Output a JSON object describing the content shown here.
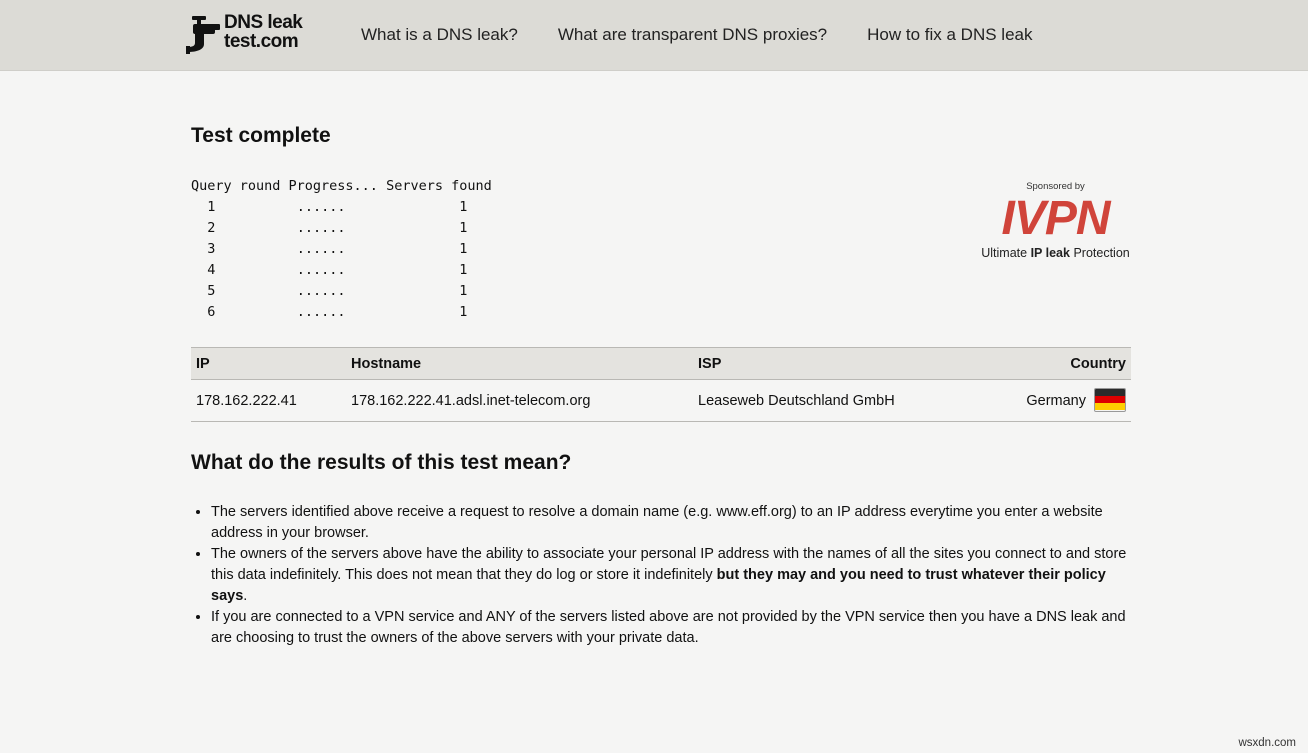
{
  "header": {
    "logo_line1": "DNS leak",
    "logo_line2": "test.com",
    "nav": [
      "What is a DNS leak?",
      "What are transparent DNS proxies?",
      "How to fix a DNS leak"
    ]
  },
  "test": {
    "title": "Test complete",
    "progress_header": "Query round Progress... Servers found",
    "rounds": [
      {
        "round": "1",
        "progress": "......",
        "servers": "1"
      },
      {
        "round": "2",
        "progress": "......",
        "servers": "1"
      },
      {
        "round": "3",
        "progress": "......",
        "servers": "1"
      },
      {
        "round": "4",
        "progress": "......",
        "servers": "1"
      },
      {
        "round": "5",
        "progress": "......",
        "servers": "1"
      },
      {
        "round": "6",
        "progress": "......",
        "servers": "1"
      }
    ]
  },
  "sponsor": {
    "label": "Sponsored by",
    "logo": "IVPN",
    "tagline_pre": "Ultimate ",
    "tagline_bold": "IP leak",
    "tagline_post": " Protection"
  },
  "results_table": {
    "headers": {
      "ip": "IP",
      "hostname": "Hostname",
      "isp": "ISP",
      "country": "Country"
    },
    "rows": [
      {
        "ip": "178.162.222.41",
        "hostname": "178.162.222.41.adsl.inet-telecom.org",
        "isp": "Leaseweb Deutschland GmbH",
        "country": "Germany",
        "flag_colors": [
          "#2b2b2b",
          "#dd0000",
          "#ffce00"
        ]
      }
    ]
  },
  "explanation": {
    "title": "What do the results of this test mean?",
    "item1": "The servers identified above receive a request to resolve a domain name (e.g. www.eff.org) to an IP address everytime you enter a website address in your browser.",
    "item2_pre": "The owners of the servers above have the ability to associate your personal IP address with the names of all the sites you connect to and store this data indefinitely. This does not mean that they do log or store it indefinitely ",
    "item2_bold": "but they may and you need to trust whatever their policy says",
    "item2_post": ".",
    "item3": "If you are connected to a VPN service and ANY of the servers listed above are not provided by the VPN service then you have a DNS leak and are choosing to trust the owners of the above servers with your private data."
  },
  "watermark": "wsxdn.com",
  "colors": {
    "header_bg": "#dcdbd6",
    "page_bg": "#f5f5f4",
    "sponsor_red": "#d0443a"
  }
}
